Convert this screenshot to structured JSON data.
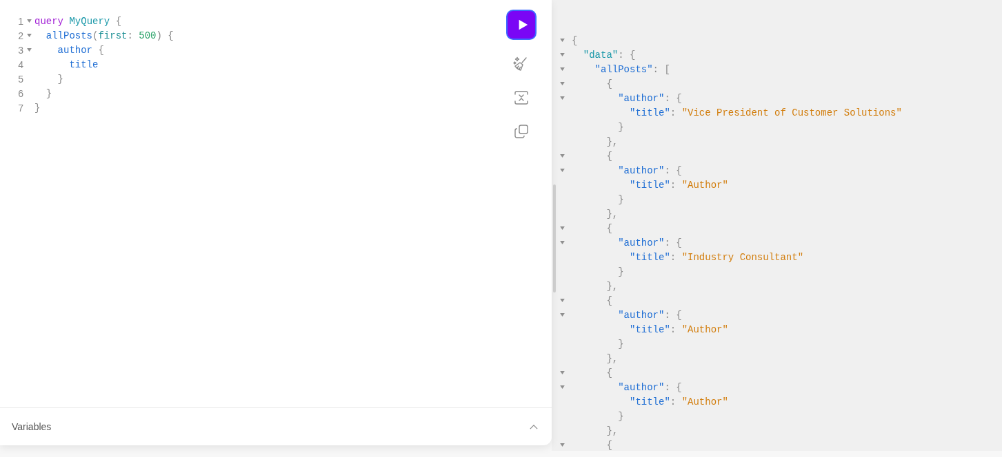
{
  "editor": {
    "lines": [
      {
        "num": "1",
        "fold": true,
        "tokens": [
          {
            "text": "query ",
            "kind": "keyword"
          },
          {
            "text": "MyQuery ",
            "kind": "def"
          },
          {
            "text": "{",
            "kind": "punct"
          }
        ],
        "children": [
          {
            "num": "2",
            "fold": true,
            "tokens": [
              {
                "text": "allPosts",
                "kind": "field"
              },
              {
                "text": "(",
                "kind": "punct"
              },
              {
                "text": "first",
                "kind": "arg"
              },
              {
                "text": ": ",
                "kind": "punct"
              },
              {
                "text": "500",
                "kind": "number"
              },
              {
                "text": ") {",
                "kind": "punct"
              }
            ],
            "children": [
              {
                "num": "3",
                "fold": true,
                "tokens": [
                  {
                    "text": "author ",
                    "kind": "field"
                  },
                  {
                    "text": "{",
                    "kind": "punct"
                  }
                ],
                "children": [
                  {
                    "num": "4",
                    "fold": false,
                    "tokens": [
                      {
                        "text": "title",
                        "kind": "field"
                      }
                    ]
                  }
                ],
                "close": {
                  "num": "5",
                  "tokens": [
                    {
                      "text": "}",
                      "kind": "punct"
                    }
                  ]
                }
              }
            ],
            "close": {
              "num": "6",
              "tokens": [
                {
                  "text": "}",
                  "kind": "punct"
                }
              ]
            }
          }
        ],
        "close": {
          "num": "7",
          "tokens": [
            {
              "text": "}",
              "kind": "punct"
            }
          ]
        }
      }
    ]
  },
  "variables": {
    "label": "Variables",
    "expanded": false
  },
  "result": {
    "lines": [
      {
        "fold": true,
        "tokens": [
          {
            "text": "{",
            "kind": "punct"
          }
        ],
        "children": [
          {
            "fold": true,
            "tokens": [
              {
                "text": "\"data\"",
                "kind": "def"
              },
              {
                "text": ": {",
                "kind": "punct"
              }
            ],
            "children": [
              {
                "fold": true,
                "tokens": [
                  {
                    "text": "\"allPosts\"",
                    "kind": "field"
                  },
                  {
                    "text": ": [",
                    "kind": "punct"
                  }
                ],
                "children": [
                  {
                    "fold": true,
                    "tokens": [
                      {
                        "text": "{",
                        "kind": "punct"
                      }
                    ],
                    "children": [
                      {
                        "fold": true,
                        "tokens": [
                          {
                            "text": "\"author\"",
                            "kind": "field"
                          },
                          {
                            "text": ": {",
                            "kind": "punct"
                          }
                        ],
                        "children": [
                          {
                            "fold": false,
                            "tokens": [
                              {
                                "text": "\"title\"",
                                "kind": "field"
                              },
                              {
                                "text": ": ",
                                "kind": "punct"
                              },
                              {
                                "text": "\"Vice President of Customer Solutions\"",
                                "kind": "string"
                              }
                            ]
                          }
                        ],
                        "close": {
                          "tokens": [
                            {
                              "text": "}",
                              "kind": "punct"
                            }
                          ]
                        }
                      }
                    ],
                    "close": {
                      "tokens": [
                        {
                          "text": "},",
                          "kind": "punct"
                        }
                      ]
                    }
                  },
                  {
                    "fold": true,
                    "tokens": [
                      {
                        "text": "{",
                        "kind": "punct"
                      }
                    ],
                    "children": [
                      {
                        "fold": true,
                        "tokens": [
                          {
                            "text": "\"author\"",
                            "kind": "field"
                          },
                          {
                            "text": ": {",
                            "kind": "punct"
                          }
                        ],
                        "children": [
                          {
                            "fold": false,
                            "tokens": [
                              {
                                "text": "\"title\"",
                                "kind": "field"
                              },
                              {
                                "text": ": ",
                                "kind": "punct"
                              },
                              {
                                "text": "\"Author\"",
                                "kind": "string"
                              }
                            ]
                          }
                        ],
                        "close": {
                          "tokens": [
                            {
                              "text": "}",
                              "kind": "punct"
                            }
                          ]
                        }
                      }
                    ],
                    "close": {
                      "tokens": [
                        {
                          "text": "},",
                          "kind": "punct"
                        }
                      ]
                    }
                  },
                  {
                    "fold": true,
                    "tokens": [
                      {
                        "text": "{",
                        "kind": "punct"
                      }
                    ],
                    "children": [
                      {
                        "fold": true,
                        "tokens": [
                          {
                            "text": "\"author\"",
                            "kind": "field"
                          },
                          {
                            "text": ": {",
                            "kind": "punct"
                          }
                        ],
                        "children": [
                          {
                            "fold": false,
                            "tokens": [
                              {
                                "text": "\"title\"",
                                "kind": "field"
                              },
                              {
                                "text": ": ",
                                "kind": "punct"
                              },
                              {
                                "text": "\"Industry Consultant\"",
                                "kind": "string"
                              }
                            ]
                          }
                        ],
                        "close": {
                          "tokens": [
                            {
                              "text": "}",
                              "kind": "punct"
                            }
                          ]
                        }
                      }
                    ],
                    "close": {
                      "tokens": [
                        {
                          "text": "},",
                          "kind": "punct"
                        }
                      ]
                    }
                  },
                  {
                    "fold": true,
                    "tokens": [
                      {
                        "text": "{",
                        "kind": "punct"
                      }
                    ],
                    "children": [
                      {
                        "fold": true,
                        "tokens": [
                          {
                            "text": "\"author\"",
                            "kind": "field"
                          },
                          {
                            "text": ": {",
                            "kind": "punct"
                          }
                        ],
                        "children": [
                          {
                            "fold": false,
                            "tokens": [
                              {
                                "text": "\"title\"",
                                "kind": "field"
                              },
                              {
                                "text": ": ",
                                "kind": "punct"
                              },
                              {
                                "text": "\"Author\"",
                                "kind": "string"
                              }
                            ]
                          }
                        ],
                        "close": {
                          "tokens": [
                            {
                              "text": "}",
                              "kind": "punct"
                            }
                          ]
                        }
                      }
                    ],
                    "close": {
                      "tokens": [
                        {
                          "text": "},",
                          "kind": "punct"
                        }
                      ]
                    }
                  },
                  {
                    "fold": true,
                    "tokens": [
                      {
                        "text": "{",
                        "kind": "punct"
                      }
                    ],
                    "children": [
                      {
                        "fold": true,
                        "tokens": [
                          {
                            "text": "\"author\"",
                            "kind": "field"
                          },
                          {
                            "text": ": {",
                            "kind": "punct"
                          }
                        ],
                        "children": [
                          {
                            "fold": false,
                            "tokens": [
                              {
                                "text": "\"title\"",
                                "kind": "field"
                              },
                              {
                                "text": ": ",
                                "kind": "punct"
                              },
                              {
                                "text": "\"Author\"",
                                "kind": "string"
                              }
                            ]
                          }
                        ],
                        "close": {
                          "tokens": [
                            {
                              "text": "}",
                              "kind": "punct"
                            }
                          ]
                        }
                      }
                    ],
                    "close": {
                      "tokens": [
                        {
                          "text": "},",
                          "kind": "punct"
                        }
                      ]
                    }
                  },
                  {
                    "fold": true,
                    "tokens": [
                      {
                        "text": "{",
                        "kind": "punct"
                      }
                    ]
                  }
                ]
              }
            ]
          }
        ]
      }
    ]
  }
}
